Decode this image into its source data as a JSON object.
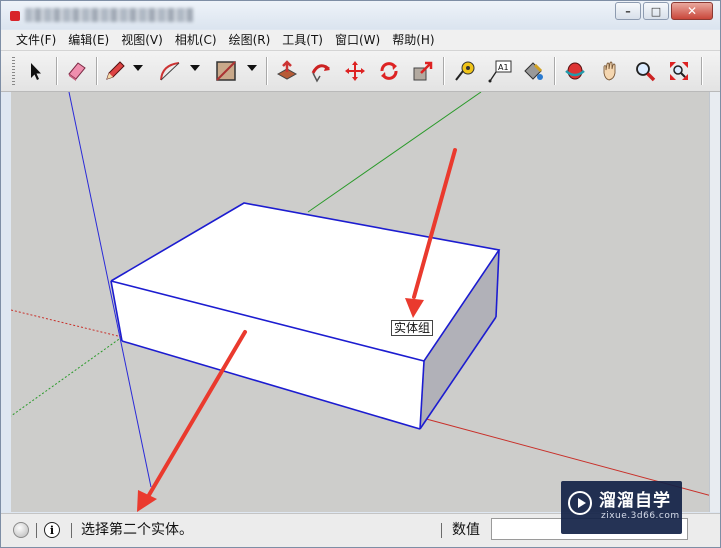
{
  "window": {
    "title_blurred": true,
    "controls": {
      "minimize_icon": "minimize-icon",
      "maximize_icon": "maximize-icon",
      "close_icon": "close-icon",
      "minimize_glyph": "–",
      "maximize_glyph": "□",
      "close_glyph": "✕"
    }
  },
  "menu": {
    "items": [
      {
        "label": "文件(F)"
      },
      {
        "label": "编辑(E)"
      },
      {
        "label": "视图(V)"
      },
      {
        "label": "相机(C)"
      },
      {
        "label": "绘图(R)"
      },
      {
        "label": "工具(T)"
      },
      {
        "label": "窗口(W)"
      },
      {
        "label": "帮助(H)"
      }
    ]
  },
  "toolbar": {
    "tools": [
      "select-tool-icon",
      "eraser-tool-icon",
      "pencil-line-tool-icon",
      "arc-tool-icon",
      "rectangle-tool-icon",
      "push-pull-tool-icon",
      "follow-me-tool-icon",
      "move-tool-icon",
      "rotate-tool-icon",
      "scale-tool-icon",
      "tape-measure-tool-icon",
      "text-tool-icon",
      "paint-bucket-tool-icon",
      "orbit-tool-icon",
      "pan-tool-icon",
      "zoom-tool-icon",
      "zoom-extents-tool-icon"
    ],
    "text_tool_badge": "A1"
  },
  "viewport": {
    "tooltip": "实体组",
    "colors": {
      "background": "#cdcdcb",
      "selection_edge": "#1c1cd0",
      "face_top": "#ffffff",
      "face_side": "#b1b1b8",
      "axis_red": "#c8302a",
      "axis_green": "#2a9a2a",
      "axis_blue": "#2a2ad8",
      "annotation_arrow": "#ea3a2e"
    }
  },
  "status": {
    "message": "选择第二个实体。",
    "measure_label": "数值",
    "measure_value": ""
  },
  "watermark": {
    "title": "溜溜自学",
    "subtitle": "zixue.3d66.com"
  }
}
